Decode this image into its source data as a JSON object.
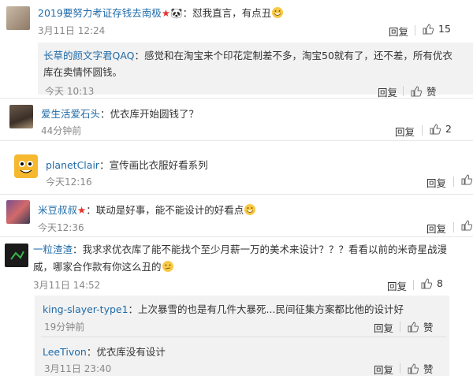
{
  "comments": [
    {
      "user": "2019要努力考证存钱去南极",
      "text": "：怼我直言，有点丑",
      "time": "3月11日 12:24",
      "reply": "回复",
      "likes": "15"
    },
    {
      "user": "爱生活爱石头",
      "text": "：优衣库开始圆钱了？",
      "time": "44分钟前",
      "reply": "回复",
      "likes": "2"
    },
    {
      "user": "planetClair",
      "text": "：宣传画比衣服好看系列",
      "time": "今天12:16",
      "reply": "回复"
    },
    {
      "user": "米豆叔叔",
      "text": "：联动是好事，能不能设计的好看点",
      "time": "今天12:36",
      "reply": "回复"
    },
    {
      "user": "一粒渣渣",
      "text_line1": "：我求求优衣库了能不能找个至少月薪一万的美术来设计？？？看看以前的米奇星战漫",
      "text_line2": "威，哪家合作款有你这么丑的",
      "time": "3月11日 14:52",
      "reply": "回复",
      "likes": "8"
    }
  ],
  "replies": [
    {
      "user": "长草的颜文字君QAQ",
      "text_line1": "：感觉和在淘宝来个印花定制差不多，淘宝50就有了，还不差，所有优衣",
      "text_line2": "库在卖情怀圆钱。",
      "time": "今天 10:13",
      "reply": "回复",
      "like": "赞"
    },
    {
      "user": "king-slayer-type1",
      "text": "：上次暴雪的也是有几件大暴死...民间征集方案都比他的设计好",
      "time": "19分钟前",
      "reply": "回复",
      "like": "赞"
    },
    {
      "user": "LeeTivon",
      "text": "：优衣库没有设计",
      "time": "3月11日 23:40",
      "reply": "回复",
      "like": "赞"
    }
  ],
  "colors": {
    "username": "#1f6ba8",
    "star": "#e5322d",
    "reply_bg": "#f2f2f2"
  }
}
